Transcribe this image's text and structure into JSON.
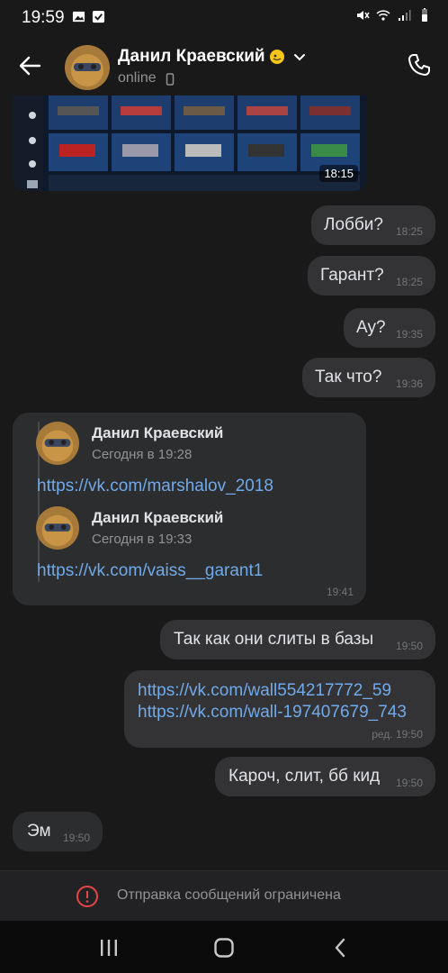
{
  "status_bar": {
    "time": "19:59"
  },
  "header": {
    "contact_name": "Данил Краевский",
    "status": "online"
  },
  "image_message": {
    "duration": "18:15"
  },
  "outgoing": [
    {
      "text": "Лобби?",
      "time": "18:25"
    },
    {
      "text": "Гарант?",
      "time": "18:25"
    },
    {
      "text": "Ау?",
      "time": "19:35"
    },
    {
      "text": "Так что?",
      "time": "19:36"
    }
  ],
  "forwarded": {
    "items": [
      {
        "name": "Данил Краевский",
        "date": "Сегодня в 19:28",
        "link": "https://vk.com/marshalov_2018"
      },
      {
        "name": "Данил Краевский",
        "date": "Сегодня в 19:33",
        "link": "https://vk.com/vaiss__garant1"
      }
    ],
    "time": "19:41"
  },
  "outgoing2": [
    {
      "text": "Так как они слиты в базы",
      "time": "19:50"
    }
  ],
  "links_message": {
    "lines": [
      "https://vk.com/wall554217772_59",
      "https://vk.com/wall-197407679_743"
    ],
    "time": "ред. 19:50"
  },
  "outgoing3": {
    "text": "Кароч, слит, бб кид",
    "time": "19:50"
  },
  "incoming_last": {
    "text": "Эм",
    "time": "19:50"
  },
  "restriction": {
    "text": "Отправка сообщений ограничена"
  },
  "colors": {
    "accent_link": "#71aaeb",
    "bubble": "#333335",
    "background": "#19191a"
  }
}
